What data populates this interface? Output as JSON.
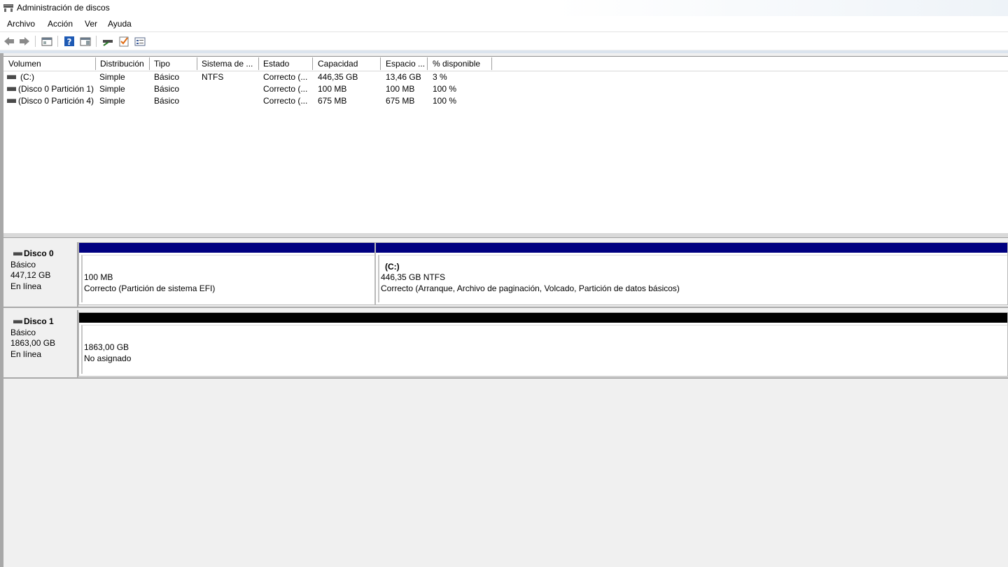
{
  "window": {
    "title": "Administración de discos"
  },
  "menu": [
    "Archivo",
    "Acción",
    "Ver",
    "Ayuda"
  ],
  "toolbar": {
    "icons": [
      "back-arrow-icon",
      "forward-arrow-icon",
      "console-tree-icon",
      "help-icon",
      "action-pane-icon",
      "disk-settings-icon",
      "check-icon",
      "properties-icon"
    ]
  },
  "volume_table": {
    "columns": [
      "Volumen",
      "Distribución",
      "Tipo",
      "Sistema de ...",
      "Estado",
      "Capacidad",
      "Espacio ...",
      "% disponible"
    ],
    "rows": [
      {
        "volumen": "(C:)",
        "distribucion": "Simple",
        "tipo": "Básico",
        "sistema": "NTFS",
        "estado": "Correcto (...",
        "capacidad": "446,35 GB",
        "espacio": "13,46 GB",
        "disponible": "3 %"
      },
      {
        "volumen": "(Disco 0 Partición 1)",
        "distribucion": "Simple",
        "tipo": "Básico",
        "sistema": "",
        "estado": "Correcto (...",
        "capacidad": "100 MB",
        "espacio": "100 MB",
        "disponible": "100 %"
      },
      {
        "volumen": "(Disco 0 Partición 4)",
        "distribucion": "Simple",
        "tipo": "Básico",
        "sistema": "",
        "estado": "Correcto (...",
        "capacidad": "675 MB",
        "espacio": "675 MB",
        "disponible": "100 %"
      }
    ]
  },
  "disks": [
    {
      "name": "Disco 0",
      "type": "Básico",
      "size": "447,12 GB",
      "status": "En línea",
      "partitions": [
        {
          "label": "",
          "size": "100 MB",
          "status": "Correcto (Partición de sistema EFI)",
          "bar_color": "#000080"
        },
        {
          "label": "(C:)",
          "size": "446,35 GB NTFS",
          "status": "Correcto (Arranque, Archivo de paginación, Volcado, Partición de datos básicos)",
          "bar_color": "#000080"
        }
      ]
    },
    {
      "name": "Disco 1",
      "type": "Básico",
      "size": "1863,00 GB",
      "status": "En línea",
      "partitions": [
        {
          "label": "",
          "size": "1863,00 GB",
          "status": "No asignado",
          "bar_color": "#000000"
        }
      ]
    }
  ]
}
